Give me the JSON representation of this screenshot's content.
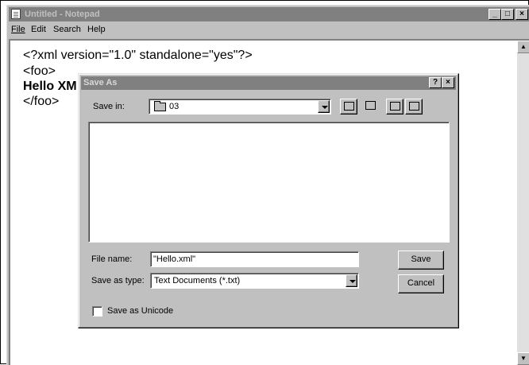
{
  "window": {
    "title": "Untitled - Notepad",
    "controls": {
      "minimize": "_",
      "maximize": "□",
      "close": "×"
    }
  },
  "menu": {
    "items": [
      "File",
      "Edit",
      "Search",
      "Help"
    ]
  },
  "editor": {
    "lines": [
      "<?xml version=\"1.0\" standalone=\"yes\"?>",
      "<foo>",
      "Hello XM",
      "</foo>"
    ]
  },
  "dialog": {
    "title": "Save As",
    "help_btn": "?",
    "close_btn": "×",
    "save_in_label": "Save in:",
    "save_in_value": "03",
    "file_name_label": "File name:",
    "file_name_value": "\"Hello.xml\"",
    "save_as_type_label": "Save as type:",
    "save_as_type_value": "Text Documents (*.txt)",
    "save_button": "Save",
    "cancel_button": "Cancel",
    "unicode_label": "Save as Unicode"
  }
}
